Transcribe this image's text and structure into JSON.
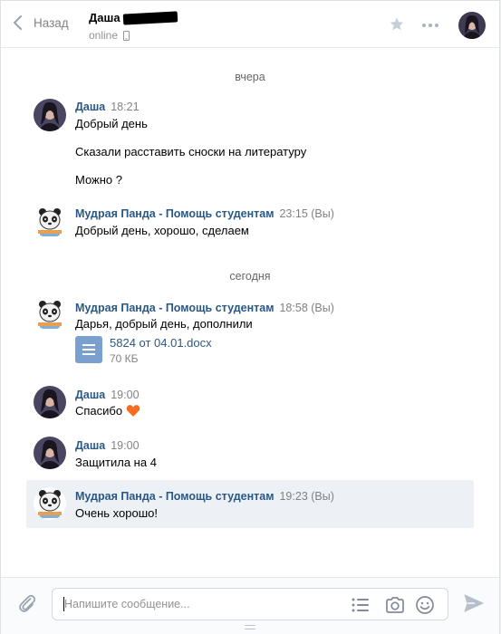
{
  "header": {
    "back_label": "Назад",
    "peer_name": "Даша",
    "peer_status": "online"
  },
  "history": {
    "day1": "вчера",
    "day2": "сегодня",
    "m1": {
      "author": "Даша",
      "time": "18:21",
      "lines": [
        "Добрый день",
        "Сказали расставить сноски на литературу",
        "Можно ?"
      ]
    },
    "m2": {
      "author": "Мудрая Панда - Помощь студентам",
      "time": "23:15 (Вы)",
      "text": "Добрый день, хорошо, сделаем"
    },
    "m3": {
      "author": "Мудрая Панда - Помощь студентам",
      "time": "18:58 (Вы)",
      "text": "Дарья, добрый день, дополнили",
      "doc": {
        "name": "5824 от 04.01.docx",
        "size": "70 КБ"
      }
    },
    "m4": {
      "author": "Даша",
      "time": "19:00",
      "text": "Спасибо",
      "emoji": "orange-heart"
    },
    "m5": {
      "author": "Даша",
      "time": "19:00",
      "text": "Защитила на 4"
    },
    "m6": {
      "author": "Мудрая Панда - Помощь студентам",
      "time": "19:23 (Вы)",
      "text": "Очень хорошо!"
    }
  },
  "composer": {
    "placeholder": "Напишите сообщение..."
  },
  "colors": {
    "link": "#2a5885",
    "accent": "#5181b8",
    "selected_row": "#edf0f5",
    "heart": "#f36d23"
  }
}
